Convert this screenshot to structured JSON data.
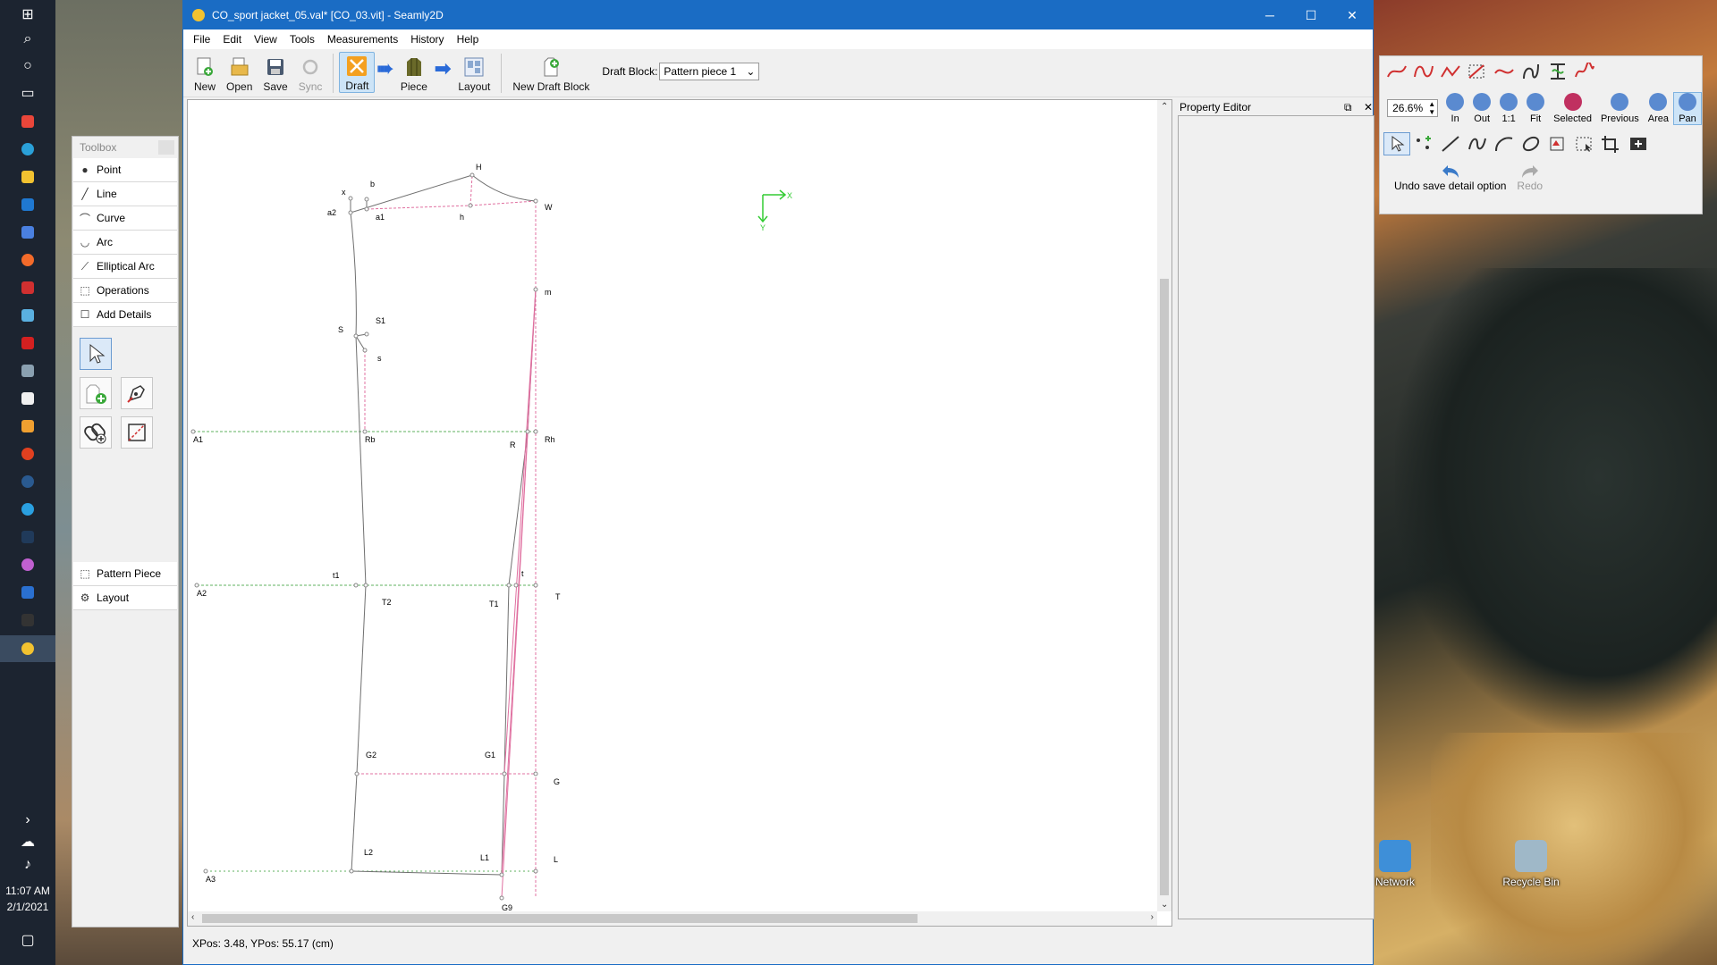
{
  "window": {
    "title": "CO_sport jacket_05.val* [CO_03.vit] - Seamly2D",
    "minimize": "─",
    "maximize": "☐",
    "close": "✕"
  },
  "menu": [
    "File",
    "Edit",
    "View",
    "Tools",
    "Measurements",
    "History",
    "Help"
  ],
  "toolbar": {
    "new": "New",
    "open": "Open",
    "save": "Save",
    "sync": "Sync",
    "draft": "Draft",
    "piece": "Piece",
    "layout": "Layout",
    "new_draft_block": "New Draft Block",
    "draft_block_label": "Draft Block:",
    "draft_block_value": "Pattern piece 1"
  },
  "toolbox": {
    "title": "Toolbox",
    "groups": [
      "Point",
      "Line",
      "Curve",
      "Arc",
      "Elliptical Arc",
      "Operations",
      "Add Details"
    ],
    "bottom": [
      "Pattern Piece",
      "Layout"
    ]
  },
  "property_editor": {
    "title": "Property Editor"
  },
  "status": {
    "position": "XPos: 3.48, YPos: 55.17 (cm)"
  },
  "palette": {
    "zoom_value": "26.6%",
    "zoom_buttons": [
      "In",
      "Out",
      "1:1",
      "Fit",
      "Selected",
      "Previous",
      "Area",
      "Pan"
    ],
    "undo": "Undo save detail option",
    "redo": "Redo"
  },
  "taskbar": {
    "time": "11:07 AM",
    "date": "2/1/2021"
  },
  "desktop_icons": [
    "Network",
    "Recycle Bin"
  ],
  "drawing": {
    "point_labels": [
      "H",
      "x",
      "b",
      "a2",
      "a1",
      "h",
      "W",
      "m",
      "S",
      "S1",
      "s",
      "A1",
      "Rb",
      "R",
      "Rh",
      "t1",
      "A2",
      "T2",
      "t",
      "T1",
      "T",
      "G2",
      "G1",
      "G",
      "L2",
      "L1",
      "L",
      "A3",
      "G9"
    ],
    "axis_x": "X",
    "axis_y": "Y"
  },
  "colors": {
    "titlebar": "#1a6cc4",
    "line_main": "#707070",
    "line_pink": "#e070a0",
    "line_green": "#5fb05f",
    "axis": "#33cc33"
  }
}
